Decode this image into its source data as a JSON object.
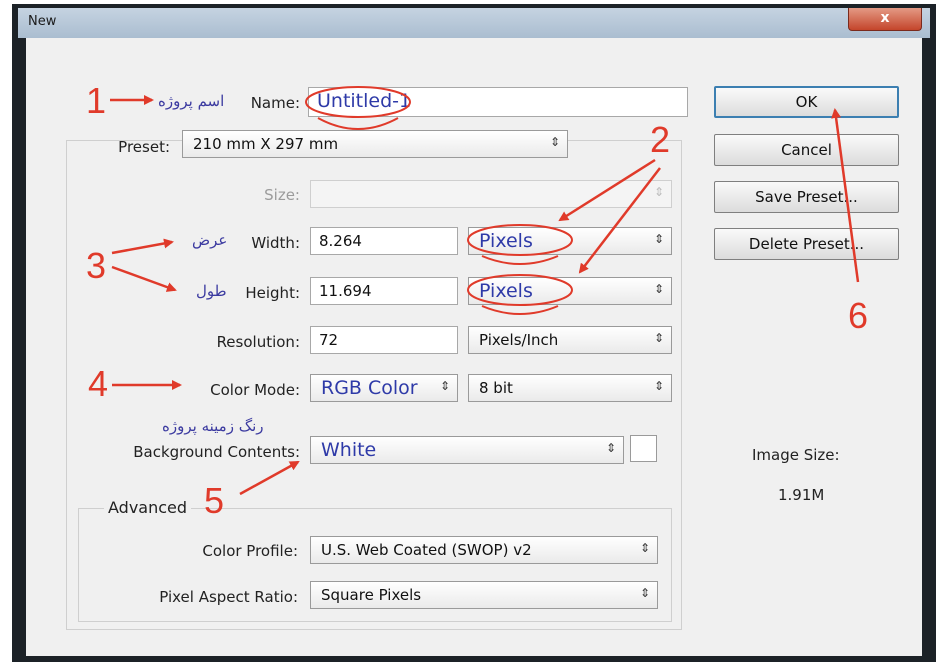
{
  "window": {
    "title": "New",
    "close_glyph": "x"
  },
  "form": {
    "name_label": "Name:",
    "name_value": "Untitled-1",
    "preset_label": "Preset:",
    "preset_value": "210 mm X 297 mm",
    "size_label": "Size:",
    "size_value": "",
    "width_label": "Width:",
    "width_value": "8.264",
    "width_unit": "Pixels",
    "height_label": "Height:",
    "height_value": "11.694",
    "height_unit": "Pixels",
    "resolution_label": "Resolution:",
    "resolution_value": "72",
    "resolution_unit": "Pixels/Inch",
    "color_mode_label": "Color Mode:",
    "color_mode_value": "RGB Color",
    "bit_depth": "8 bit",
    "background_label": "Background Contents:",
    "background_value": "White",
    "advanced_label": "Advanced",
    "color_profile_label": "Color Profile:",
    "color_profile_value": "U.S. Web Coated (SWOP) v2",
    "pixel_aspect_label": "Pixel Aspect Ratio:",
    "pixel_aspect_value": "Square Pixels"
  },
  "buttons": {
    "ok": "OK",
    "cancel": "Cancel",
    "save_preset": "Save Preset...",
    "delete_preset": "Delete Preset..."
  },
  "image_size": {
    "label": "Image Size:",
    "value": "1.91M"
  },
  "annotations": {
    "name_fa": "اسم پروژه",
    "width_fa": "عرض",
    "height_fa": "طول",
    "background_fa": "رنگ زمینه پروژه",
    "n1": "1",
    "n2": "2",
    "n3": "3",
    "n4": "4",
    "n5": "5",
    "n6": "6",
    "color": "#e03a2a"
  }
}
